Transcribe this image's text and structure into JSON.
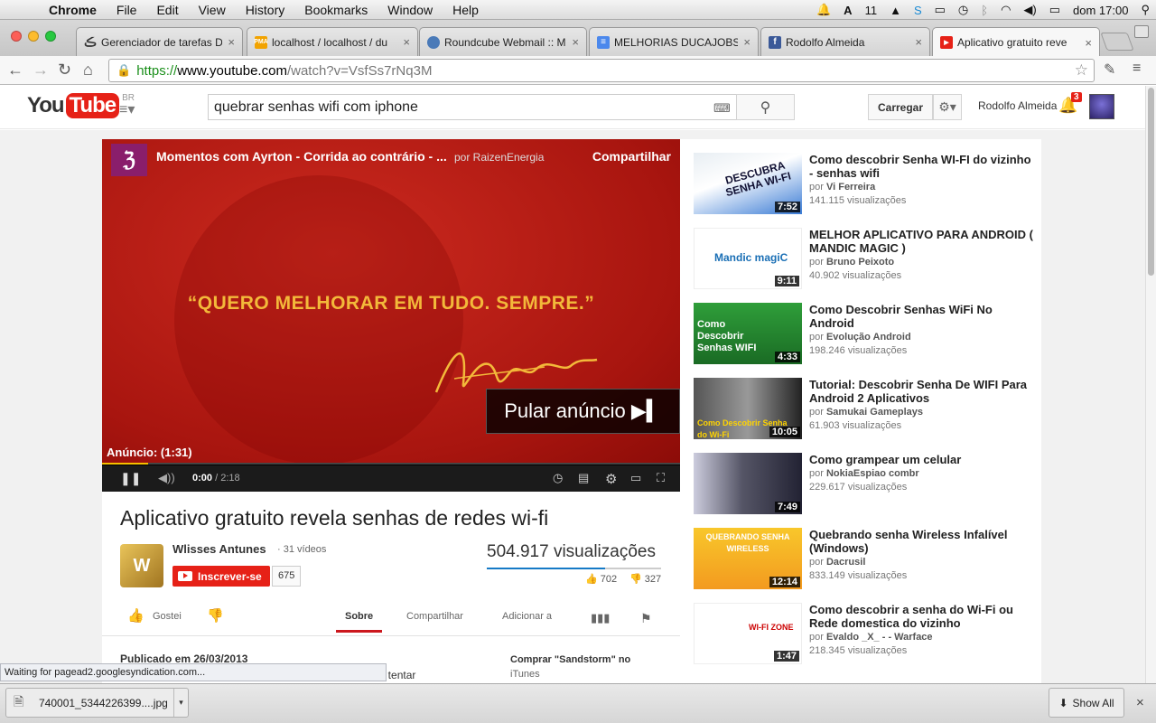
{
  "menubar": {
    "app": "Chrome",
    "items": [
      "File",
      "Edit",
      "View",
      "History",
      "Bookmarks",
      "Window",
      "Help"
    ],
    "status_icons": [
      "bell-icon",
      "font-icon",
      "drive-icon",
      "skype-icon",
      "monitor-icon",
      "time-machine-icon",
      "bluetooth-icon",
      "wifi-icon",
      "volume-icon",
      "battery-icon",
      "spotlight-icon"
    ],
    "badge": "11",
    "clock": "dom 17:00"
  },
  "tabs": [
    {
      "title": "Gerenciador de tarefas Du",
      "icon": "task-manager-icon"
    },
    {
      "title": "localhost / localhost / du",
      "icon": "phpmyadmin-icon"
    },
    {
      "title": "Roundcube Webmail :: M",
      "icon": "roundcube-icon"
    },
    {
      "title": "MELHORIAS DUCAJOBS – G",
      "icon": "google-docs-icon"
    },
    {
      "title": "Rodolfo Almeida",
      "icon": "facebook-icon"
    },
    {
      "title": "Aplicativo gratuito reve",
      "icon": "youtube-icon"
    }
  ],
  "address": {
    "scheme": "https://",
    "domain": "www.youtube.com",
    "path": "/watch?v=VsfSs7rNq3M"
  },
  "youtube": {
    "logo_you": "You",
    "logo_tube": "Tube",
    "region": "BR",
    "search_query": "quebrar senhas wifi com iphone",
    "upload_label": "Carregar",
    "user_name": "Rodolfo Almeida",
    "notifications": "3"
  },
  "player": {
    "ad_logo": "ℨ",
    "ad_title": "Momentos com Ayrton - Corrida ao contrário - ...",
    "ad_by": "por RaizenEnergia",
    "share": "Compartilhar",
    "quote": "“QUERO MELHORAR EM TUDO. SEMPRE.”",
    "skip_label": "Pular anúncio ▶▍",
    "ad_countdown": "Anúncio: (1:31)",
    "current_time": "0:00",
    "duration": "/ 2:18",
    "ad_progress": 0.08
  },
  "video": {
    "title": "Aplicativo gratuito revela senhas de redes wi-fi",
    "channel": "Wlisses Antunes",
    "video_count": "· 31 vídeos",
    "subscribe_label": "Inscrever-se",
    "subscriber_count": "675",
    "views": "504.917 visualizações",
    "likes": "702",
    "dislikes": "327",
    "like_ratio": 0.68,
    "like_label": "Gostei",
    "tabs": [
      "Sobre",
      "Compartilhar",
      "Adicionar a"
    ],
    "published": "Publicado em 26/03/2013",
    "desc_fragment": "de tentar",
    "buy_label": "Comprar \"Sandstorm\" no",
    "buy_store": "iTunes"
  },
  "related": [
    {
      "title": "Como descobrir Senha WI-FI do vizinho - senhas wifi",
      "by": "Vi Ferreira",
      "views": "141.115 visualizações",
      "duration": "7:52",
      "thumb_text": "DESCUBRA SENHA WI-FI"
    },
    {
      "title": "MELHOR APLICATIVO PARA ANDROID ( MANDIC MAGIC )",
      "by": "Bruno Peixoto",
      "views": "40.902 visualizações",
      "duration": "9:11",
      "thumb_text": "Mandic magiC"
    },
    {
      "title": "Como Descobrir Senhas WiFi No Android",
      "by": "Evolução Android",
      "views": "198.246 visualizações",
      "duration": "4:33",
      "thumb_text": "Como Descobrir Senhas WIFI"
    },
    {
      "title": "Tutorial: Descobrir Senha De WIFI Para Android 2 Aplicativos",
      "by": "Samukai Gameplays",
      "views": "61.903 visualizações",
      "duration": "10:05",
      "thumb_text": "Como Descobrir Senha do Wi-Fi"
    },
    {
      "title": "Como grampear um celular",
      "by": "NokiaEspiao combr",
      "views": "229.617 visualizações",
      "duration": "7:49",
      "thumb_text": ""
    },
    {
      "title": "Quebrando senha Wireless Infalível (Windows)",
      "by": "Dacrusil",
      "views": "833.149 visualizações",
      "duration": "12:14",
      "thumb_text": "QUEBRANDO SENHA WIRELESS"
    },
    {
      "title": "Como descobrir a senha do Wi-Fi ou Rede domestica do vizinho",
      "by": "Evaldo _X_ - - Warface",
      "views": "218.345 visualizações",
      "duration": "1:47",
      "thumb_text": "WI-FI ZONE"
    }
  ],
  "by_prefix": "por",
  "status_text": "Waiting for pagead2.googlesyndication.com...",
  "download": {
    "file": "740001_5344226399....jpg",
    "show_all": "Show All"
  },
  "colors": {
    "youtube_red": "#e62117",
    "secure_green": "#1b8f1b",
    "ad_yellow": "#f6c000",
    "like_blue": "#167ac6"
  }
}
